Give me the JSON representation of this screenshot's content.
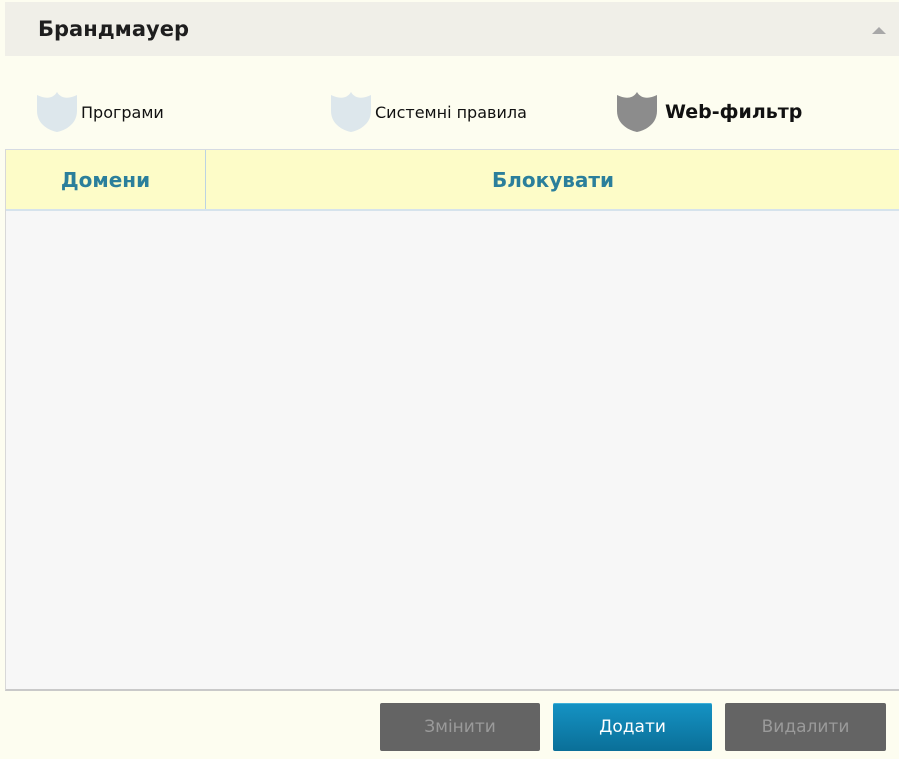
{
  "panel": {
    "title": "Брандмауер",
    "collapse_icon": "triangle-up-icon"
  },
  "tabs": [
    {
      "label": "Програми",
      "icon": "shield-icon",
      "active": false,
      "icon_color": "#dde7ec"
    },
    {
      "label": "Системні правила",
      "icon": "shield-icon",
      "active": false,
      "icon_color": "#dde7ec"
    },
    {
      "label": "Web-фильтр",
      "icon": "shield-icon",
      "active": true,
      "icon_color": "#8c8c8c"
    }
  ],
  "table": {
    "columns": [
      "Домени",
      "Блокувати"
    ],
    "rows": []
  },
  "footer": {
    "edit_label": "Змінити",
    "add_label": "Додати",
    "delete_label": "Видалити"
  },
  "colors": {
    "header_text": "#2b7f9b",
    "header_bg": "#fdfcc8",
    "primary_button": "#0f82b0",
    "disabled_button": "#646464"
  }
}
